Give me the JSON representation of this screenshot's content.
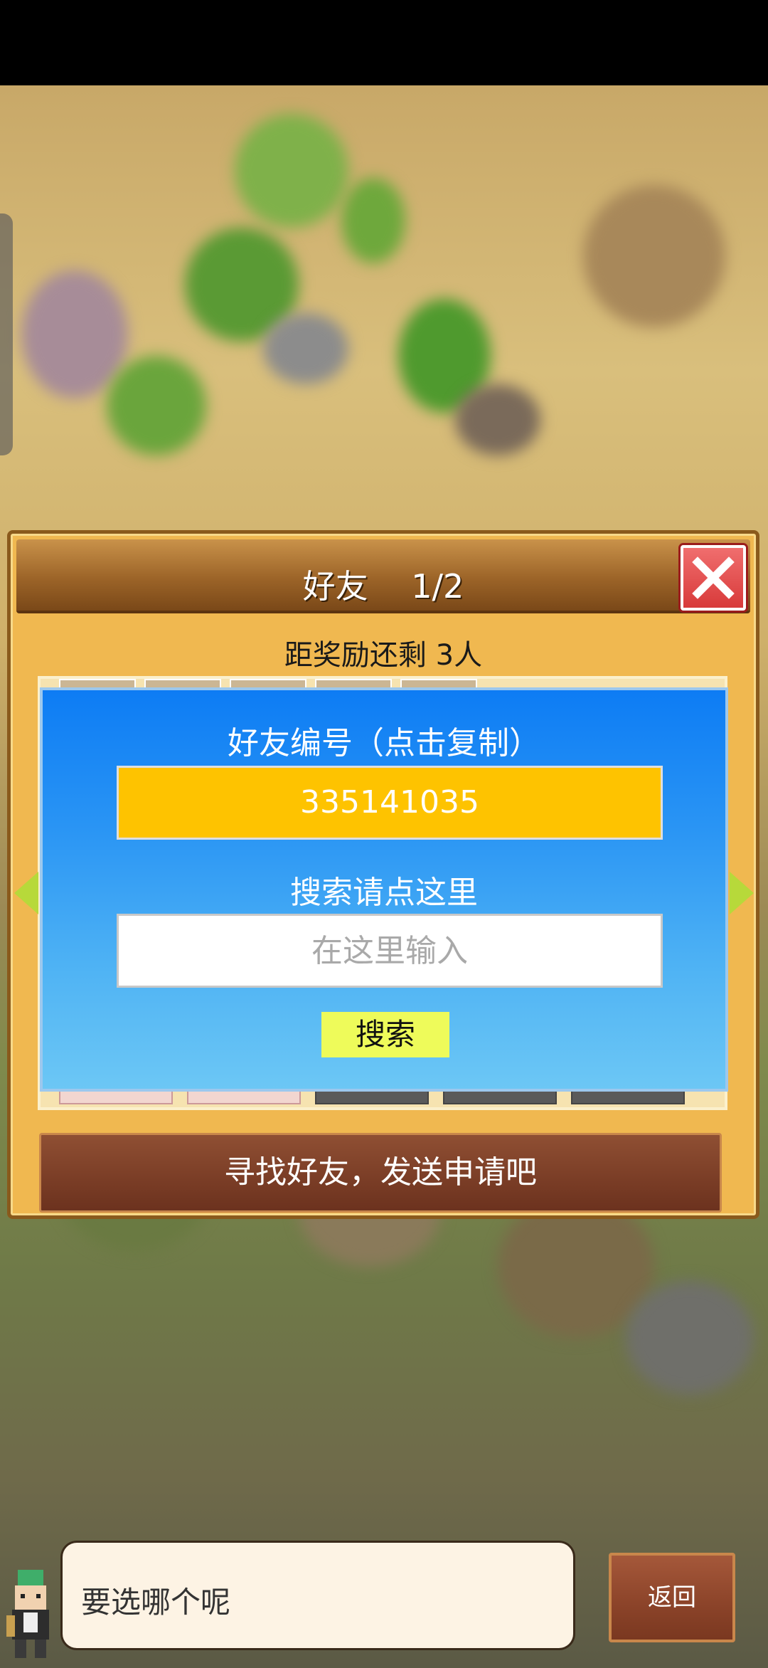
{
  "dialog": {
    "title": "好友　 1/2",
    "reward_text": "距奖励还剩 3人",
    "find_friends_label": "寻找好友，发送申请吧"
  },
  "search_panel": {
    "friend_id_label": "好友编号（点击复制）",
    "friend_id_value": "335141035",
    "search_label": "搜索请点这里",
    "search_placeholder": "在这里输入",
    "search_button_label": "搜索"
  },
  "bottom_bar": {
    "message": "要选哪个呢",
    "back_label": "返回"
  },
  "icons": {
    "close": "close-icon",
    "left_arrow": "arrow-left-icon",
    "right_arrow": "arrow-right-icon",
    "avatar": "character-avatar-icon"
  },
  "colors": {
    "panel_blue": "#1a88f4",
    "id_box_yellow": "#fec300",
    "search_button": "#eefb5a",
    "dialog_orange": "#f0b850",
    "button_brown": "#7a3d26",
    "close_red": "#e04848"
  }
}
